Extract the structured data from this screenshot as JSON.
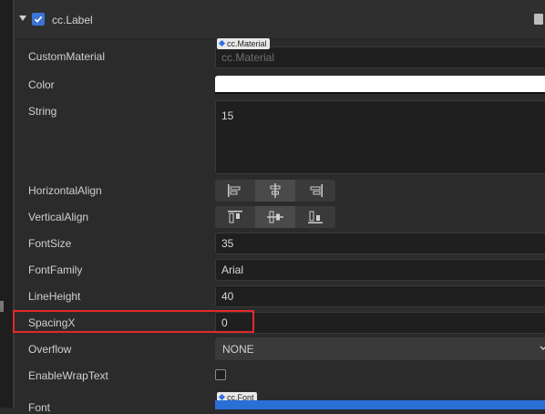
{
  "component": {
    "title": "cc.Label"
  },
  "properties": {
    "custom_material": {
      "label": "CustomMaterial",
      "tag": "cc.Material",
      "placeholder": "cc.Material"
    },
    "color": {
      "label": "Color",
      "value": "#ffffff"
    },
    "string": {
      "label": "String",
      "value": "15"
    },
    "horizontal_align": {
      "label": "HorizontalAlign",
      "options": [
        "left",
        "center",
        "right"
      ],
      "selected": "center"
    },
    "vertical_align": {
      "label": "VerticalAlign",
      "options": [
        "top",
        "center",
        "bottom"
      ],
      "selected": "center"
    },
    "font_size": {
      "label": "FontSize",
      "value": "35"
    },
    "font_family": {
      "label": "FontFamily",
      "value": "Arial"
    },
    "line_height": {
      "label": "LineHeight",
      "value": "40"
    },
    "spacing_x": {
      "label": "SpacingX",
      "value": "0"
    },
    "overflow": {
      "label": "Overflow",
      "value": "NONE"
    },
    "enable_wrap_text": {
      "label": "EnableWrapText",
      "checked": false
    },
    "font": {
      "label": "Font",
      "tag": "cc.Font"
    }
  },
  "colors": {
    "accent": "#3b74d7",
    "highlight": "#e22a2a",
    "background": "#2b2b2b",
    "field": "#1f1f1f"
  }
}
